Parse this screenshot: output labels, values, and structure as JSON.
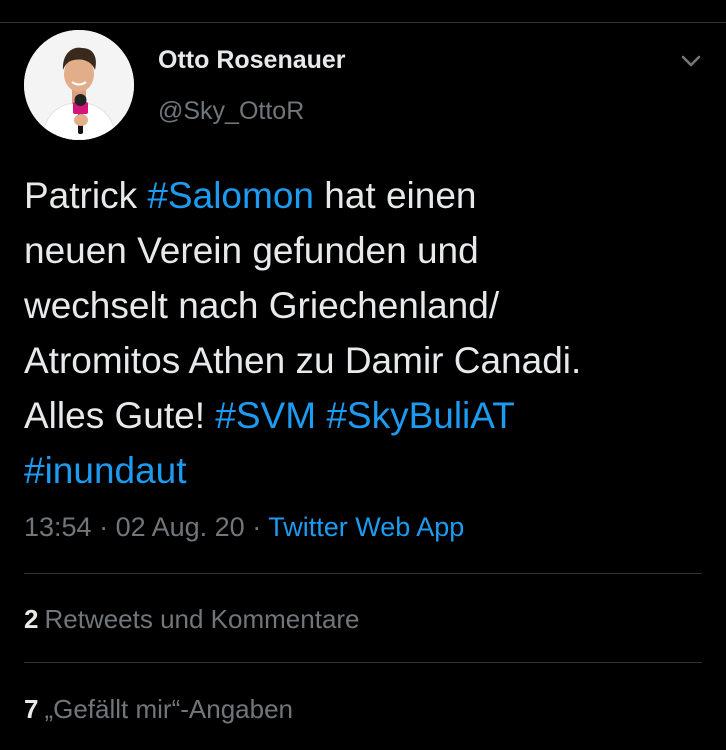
{
  "author": {
    "display_name": "Otto Rosenauer",
    "handle": "@Sky_OttoR"
  },
  "tweet": {
    "lines": [
      [
        {
          "text": "Patrick ",
          "hashtag": false
        },
        {
          "text": "#Salomon",
          "hashtag": true
        },
        {
          "text": " hat einen",
          "hashtag": false
        }
      ],
      [
        {
          "text": "neuen Verein gefunden und",
          "hashtag": false
        }
      ],
      [
        {
          "text": "wechselt nach Griechenland/",
          "hashtag": false
        }
      ],
      [
        {
          "text": "Atromitos Athen zu Damir Canadi.",
          "hashtag": false
        }
      ],
      [
        {
          "text": "Alles Gute! ",
          "hashtag": false
        },
        {
          "text": "#SVM",
          "hashtag": true
        },
        {
          "text": " ",
          "hashtag": false
        },
        {
          "text": "#SkyBuliAT",
          "hashtag": true
        }
      ],
      [
        {
          "text": "#inundaut",
          "hashtag": true
        }
      ]
    ]
  },
  "meta": {
    "time": "13:54",
    "separator": " · ",
    "date": "02 Aug. 20",
    "source": "Twitter Web App"
  },
  "stats": {
    "retweets_count": "2",
    "retweets_label": "Retweets und Kommentare",
    "likes_count": "7",
    "likes_label": "„Gefällt mir“-Angaben"
  },
  "icons": {
    "menu": "chevron-down-icon",
    "avatar": "profile-photo"
  },
  "colors": {
    "background": "#000000",
    "text": "#e7e9ea",
    "muted": "#71767b",
    "link": "#1d9bf0",
    "divider": "#2f3336"
  }
}
